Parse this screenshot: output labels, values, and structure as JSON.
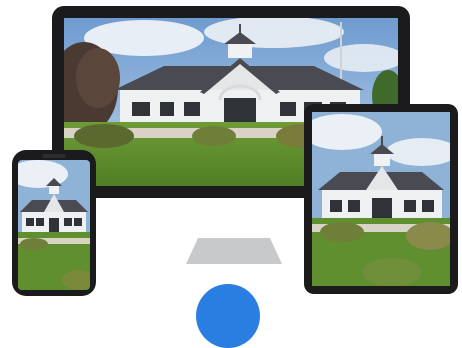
{
  "scene": {
    "subject": "building-photo",
    "devices": [
      "desktop-monitor",
      "tablet",
      "phone"
    ]
  },
  "colors": {
    "page_background": "#ffffff",
    "device_frame": "#1b1b1d",
    "monitor_chin": "#ffffff",
    "monitor_stand": "#c7c9cb",
    "sky": "#8fb3d6",
    "cloud": "#f4f6f8",
    "roof": "#4a4b52",
    "wall": "#eef0f2",
    "window": "#2f3236",
    "lawn": "#5f8f2e",
    "shrub": "#6f7f3a",
    "path": "#d9d3c5",
    "accent_circle": "#2a7de1"
  },
  "icons": {
    "accent": "blue-circle-icon"
  }
}
